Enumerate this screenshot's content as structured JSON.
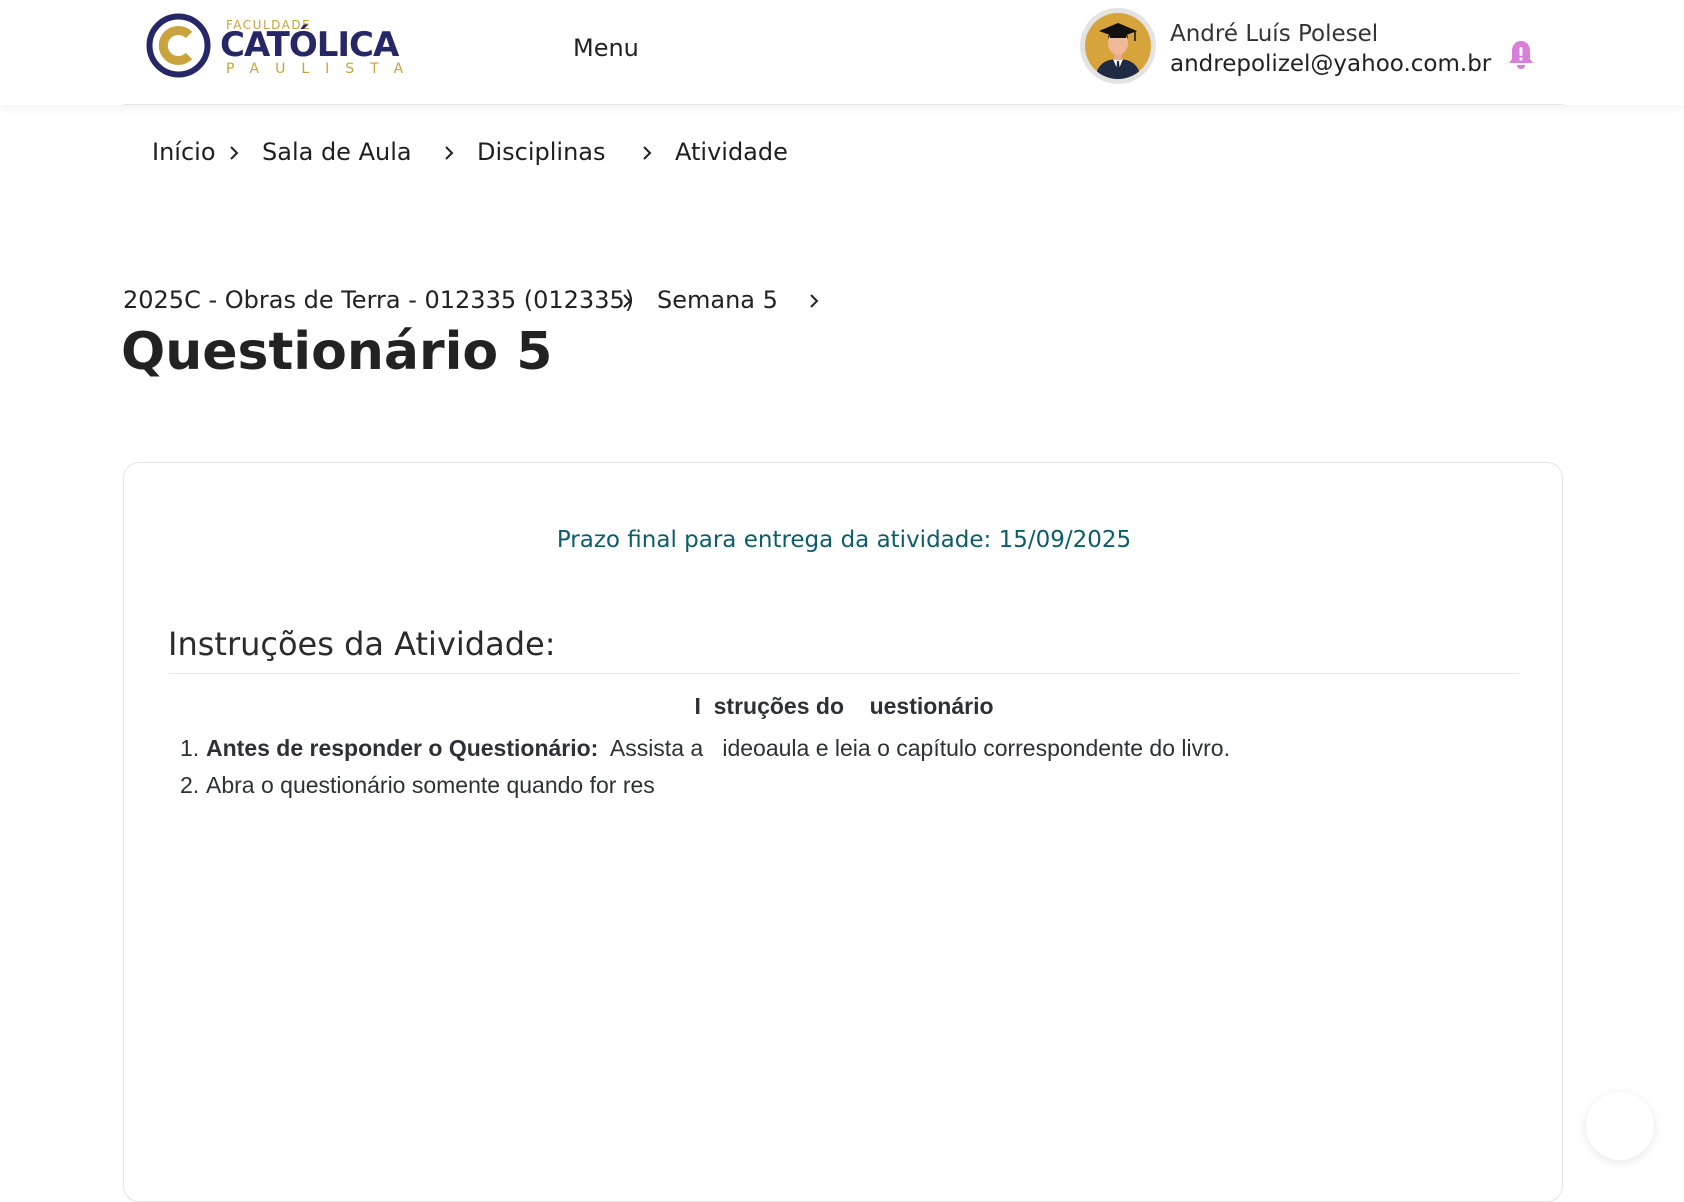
{
  "brand": {
    "logo_small": "FACULDADE",
    "logo_main": "CATÓLICA",
    "logo_sub": "PAULISTA",
    "primary_color": "#262766",
    "accent_color": "#c9a33d"
  },
  "header": {
    "menu_label": "Menu",
    "user": {
      "name": "André Luís Polesel",
      "email": "andrepolizel@yahoo.com.br",
      "avatar_icon": "graduate-avatar-icon"
    },
    "notification_icon": "bell-icon",
    "notification_color": "#d77fd9"
  },
  "breadcrumb": {
    "items": [
      "Início",
      "Sala de Aula",
      "Disciplinas",
      "Atividade"
    ],
    "separator_icon": "chevron-right-icon"
  },
  "course_path": {
    "course": "2025C - Obras de Terra - 012335 (012335)",
    "week": "Semana 5"
  },
  "page": {
    "title": "Questionário 5"
  },
  "activity": {
    "deadline": "Prazo final para entrega da atividade: 15/09/2025",
    "deadline_color": "#0c5d6a",
    "instructions_heading": "Instruções da Atividade:",
    "instructions_subtitle": "I  struções do    uestionário",
    "items": [
      {
        "number": "1.",
        "bold": "Antes de responder o Questionário:",
        "text": "  Assista a   ideoaula e leia o capítulo correspondente do livro."
      },
      {
        "number": "2.",
        "bold": "",
        "text": "Abra o questionário somente quando for res"
      }
    ]
  }
}
